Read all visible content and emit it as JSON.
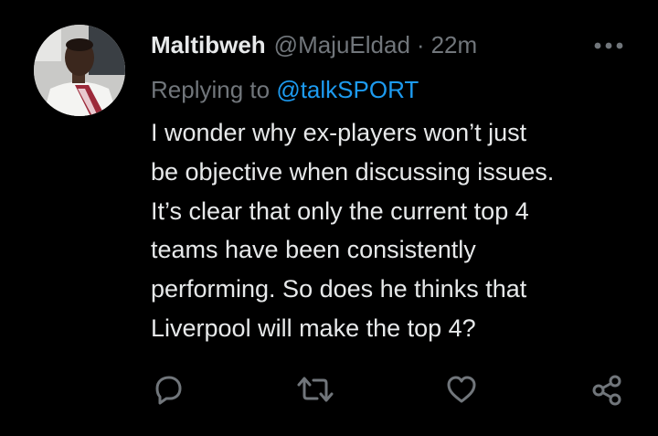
{
  "tweet": {
    "display_name": "Maltibweh",
    "handle": "@MajuEldad",
    "separator": "·",
    "time": "22m",
    "replying_prefix": "Replying to",
    "replying_to": "@talkSPORT",
    "text_lines": [
      "I wonder why ex-players won’t just",
      "be objective when discussing issues.",
      "It’s clear that only the current top 4",
      "teams have been consistently",
      "performing. So does he thinks that",
      "Liverpool will make the top 4?"
    ]
  },
  "icons": {
    "more": "more-horizontal-icon",
    "reply": "reply-icon",
    "retweet": "retweet-icon",
    "like": "heart-icon",
    "share": "share-icon"
  },
  "colors": {
    "background": "#000000",
    "text": "#e7e9ea",
    "muted": "#71767b",
    "link": "#1d9bf0"
  }
}
